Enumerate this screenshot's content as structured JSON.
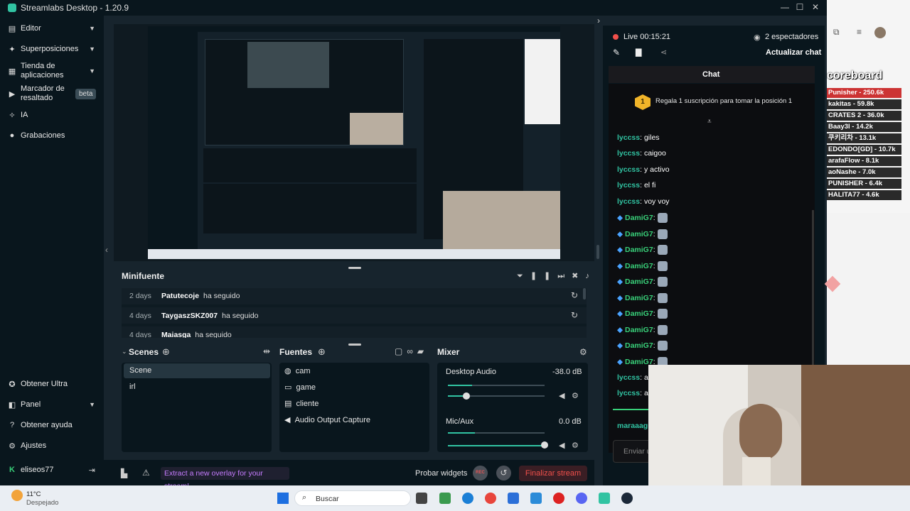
{
  "window": {
    "title": "Streamlabs Desktop - 1.20.9"
  },
  "sidebar": {
    "items": [
      {
        "label": "Editor"
      },
      {
        "label": "Superposiciones"
      },
      {
        "label": "Tienda de aplicaciones"
      },
      {
        "label": "Marcador de resaltado",
        "badge": "beta"
      },
      {
        "label": "IA"
      },
      {
        "label": "Grabaciones"
      }
    ],
    "bottom": [
      {
        "label": "Obtener Ultra"
      },
      {
        "label": "Panel"
      },
      {
        "label": "Obtener ayuda"
      },
      {
        "label": "Ajustes"
      },
      {
        "label": "eliseos77"
      }
    ]
  },
  "minifeed": {
    "title": "Minifuente",
    "rows": [
      {
        "age": "2 days",
        "name": "Patutecoje",
        "action": "ha seguido"
      },
      {
        "age": "4 days",
        "name": "TaygaszSKZ007",
        "action": "ha seguido"
      },
      {
        "age": "4 days",
        "name": "Maiasga",
        "action": "ha seguido"
      }
    ]
  },
  "scenes": {
    "title": "Scenes",
    "items": [
      "Scene",
      "irl"
    ]
  },
  "sources": {
    "title": "Fuentes",
    "items": [
      "cam",
      "game",
      "cliente",
      "Audio Output Capture"
    ]
  },
  "mixer": {
    "title": "Mixer",
    "channels": [
      {
        "name": "Desktop Audio",
        "db": "-38.0 dB",
        "level": 0.18
      },
      {
        "name": "Mic/Aux",
        "db": "0.0 dB",
        "level": 1.0
      }
    ]
  },
  "bottombar": {
    "promo": "Extract a new overlay for your stream!",
    "test_widgets": "Probar widgets",
    "rec": "REC",
    "end_stream": "Finalizar stream"
  },
  "live": {
    "status": "Live 00:15:21",
    "viewers": "2 espectadores",
    "refresh_chat": "Actualizar chat"
  },
  "chat": {
    "title": "Chat",
    "banner": "Regala 1 suscripción para tomar la posición 1",
    "banner_rank": "1",
    "messages": [
      {
        "user": "lyccss",
        "text": ": giles"
      },
      {
        "user": "lyccss",
        "text": ": caigoo"
      },
      {
        "user": "lyccss",
        "text": ": y activo"
      },
      {
        "user": "lyccss",
        "text": ": el fi"
      },
      {
        "user": "lyccss",
        "text": ": voy voy"
      },
      {
        "user": "DamiG7",
        "text": ":"
      },
      {
        "user": "DamiG7",
        "text": ":"
      },
      {
        "user": "DamiG7",
        "text": ":"
      },
      {
        "user": "DamiG7",
        "text": ":"
      },
      {
        "user": "DamiG7",
        "text": ":"
      },
      {
        "user": "DamiG7",
        "text": ":"
      },
      {
        "user": "DamiG7",
        "text": ":"
      },
      {
        "user": "DamiG7",
        "text": ":"
      },
      {
        "user": "DamiG7",
        "text": ":"
      },
      {
        "user": "DamiG7",
        "text": ":"
      },
      {
        "user": "lyccss",
        "text": ": ar"
      },
      {
        "user": "lyccss",
        "text": ": ar"
      }
    ],
    "partial_user": "maraaagu",
    "input_placeholder": "Enviar u"
  },
  "scoreboard": {
    "title": "coreboard",
    "rows": [
      "Punisher - 250.6k",
      "kakitas - 59.8k",
      "CRATES 2 - 36.0k",
      "Baay3l - 14.2k",
      "쿠키리차 - 13.1k",
      "EDONDO[GD] - 10.7k",
      "arafaFlow - 8.1k",
      "aoNashe - 7.0k",
      "PUNISHER - 6.4k",
      "HALITA77 - 4.6k"
    ]
  },
  "taskbar": {
    "weather_temp": "11°C",
    "weather_desc": "Despejado",
    "search_placeholder": "Buscar"
  },
  "colors": {
    "accent": "#31c3a2",
    "danger": "#f1504b",
    "bg": "#17242d",
    "panel": "#09161d"
  }
}
